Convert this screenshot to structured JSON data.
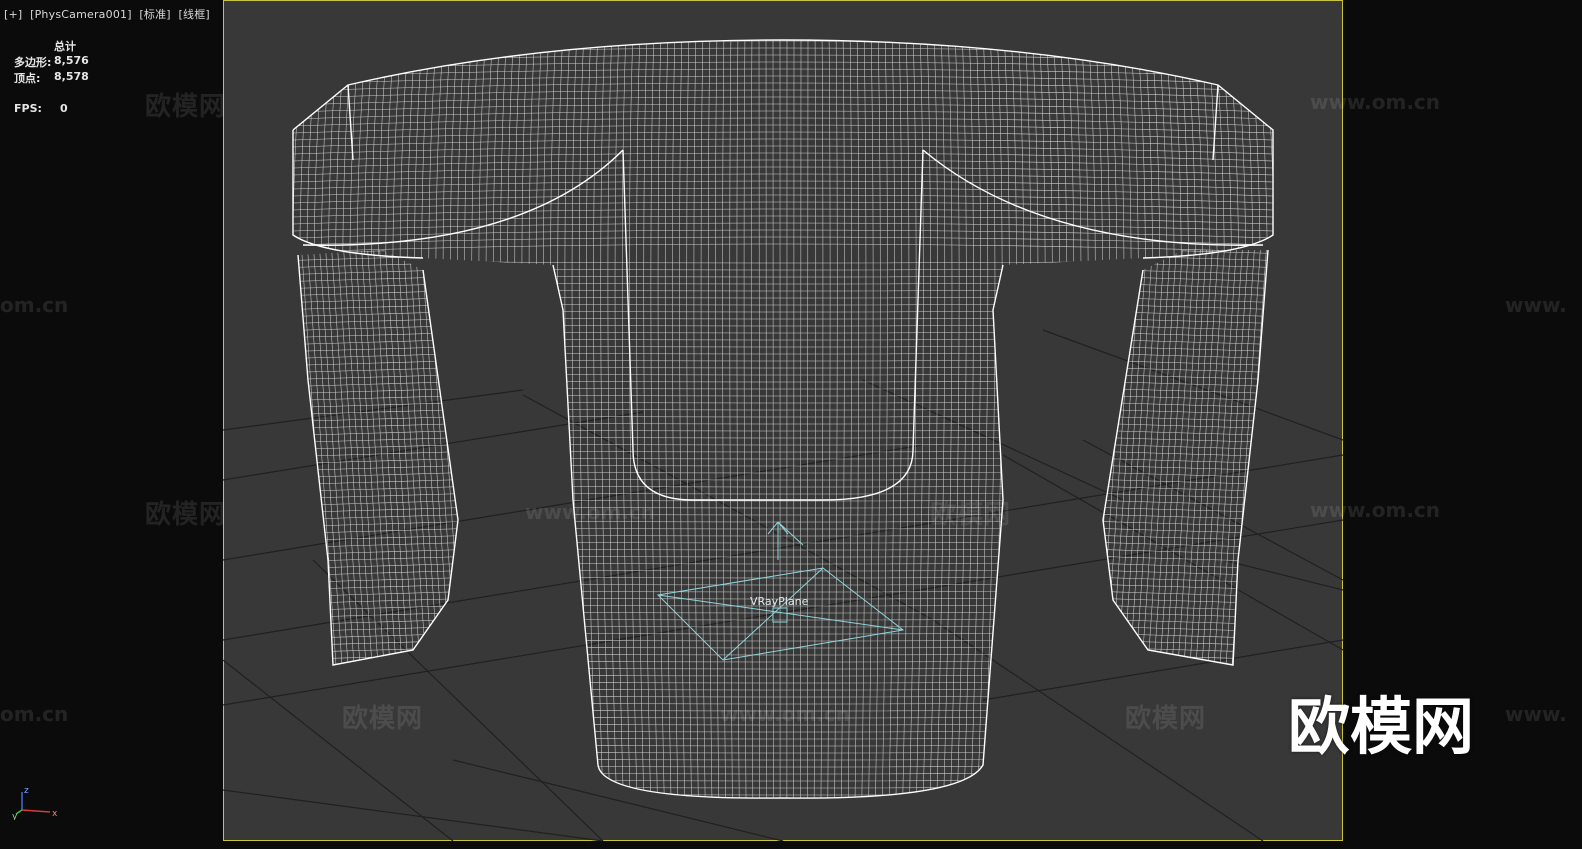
{
  "viewport_label": {
    "plus": "[+]",
    "camera": "[PhysCamera001]",
    "shading_standard": "[标准]",
    "shading_mode": "[线框]"
  },
  "stats": {
    "header": "总计",
    "polygons_label": "多边形:",
    "polygons_value": "8,576",
    "vertices_label": "顶点:",
    "vertices_value": "8,578",
    "fps_label": "FPS:",
    "fps_value": "0"
  },
  "scene": {
    "helper_label": "VRayPlane"
  },
  "watermarks": {
    "cn": "欧模网",
    "url": "www.om.cn",
    "url_partial_left": "om.cn",
    "url_partial_right": "www."
  },
  "logo": "欧模网",
  "axis": {
    "x": "x",
    "y": "y",
    "z": "z"
  },
  "colors": {
    "viewport_bg": "#383838",
    "viewport_border": "#c9c43a",
    "wire": "#ffffff",
    "helper": "#8fd6dc",
    "grid": "#1e1e1e"
  }
}
